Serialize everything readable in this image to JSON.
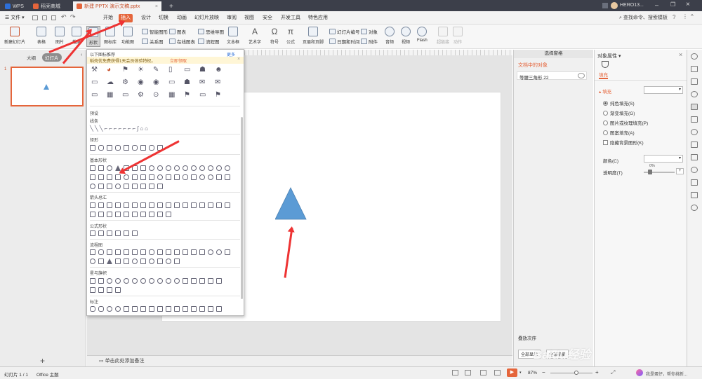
{
  "titlebar": {
    "tabs": [
      {
        "label": "WPS"
      },
      {
        "label": "稻壳商城"
      },
      {
        "label": "新建 PPTX 演示文稿.pptx"
      }
    ],
    "user": "HERO13..."
  },
  "menubar": {
    "file": "文件",
    "items": [
      "开始",
      "插入",
      "设计",
      "切换",
      "动画",
      "幻灯片放映",
      "审阅",
      "视图",
      "安全",
      "开发工具",
      "特色应用"
    ],
    "search": "查找命令、搜索模板"
  },
  "toolbar": {
    "new_slide": "新建幻灯片",
    "table": "表格",
    "image": "图片",
    "screenshot": "截屏",
    "shape": "形状",
    "icon_lib": "图标库",
    "func_chart": "功能图",
    "smart_art": "智能图形",
    "chart": "图表",
    "mindmap": "思维导图",
    "relation": "关系图",
    "online_chart": "在线图表",
    "flowchart": "流程图",
    "textbox": "文本框",
    "art_text": "艺术字",
    "symbol": "符号",
    "formula": "公式",
    "header_footer": "页眉和页脚",
    "slide_number": "幻灯片编号",
    "date_time": "日期和时间",
    "object": "对象",
    "attachment": "附件",
    "audio": "音频",
    "video": "视频",
    "flash": "Flash",
    "hyperlink": "超链接",
    "action": "动作"
  },
  "leftpanel": {
    "tab_outline": "大纲",
    "tab_slides": "幻灯片",
    "slide_number": "1"
  },
  "popup": {
    "header": "以下图标推荐",
    "more": "更多",
    "promo": "稻壳优免费获得1天会员体验特权。",
    "promo_link": "立即领取",
    "sections": [
      "预设",
      "线条",
      "矩形",
      "基本形状",
      "箭头总汇",
      "公式形状",
      "流程图",
      "星与旗帜",
      "标注"
    ]
  },
  "notes": {
    "placeholder": "单击此处添加备注"
  },
  "selpane": {
    "title": "选择窗格",
    "objects_label": "文档中的对象",
    "item": "等腰三角形 22",
    "order_label": "叠放次序",
    "show_all": "全部显示",
    "hide_all": "全部隐藏"
  },
  "proppane": {
    "title": "对象属性",
    "tab_fill": "填充",
    "section_fill": "填充",
    "options": [
      "纯色填充(S)",
      "渐变填充(G)",
      "图片或纹理填充(P)",
      "图案填充(A)"
    ],
    "hide_bg": "隐藏背景图形(K)",
    "color_label": "颜色(C)",
    "transparency_label": "透明度(T)",
    "transparency_value": "0%"
  },
  "statusbar": {
    "slide_info": "幻灯片 1 / 1",
    "theme": "Office 主题",
    "zoom": "87%",
    "assistant": "我是蛋仔，帮你挑新..."
  },
  "colors": {
    "accent": "#e5653b",
    "shape_fill": "#5b9bd5",
    "arrow": "#e33333"
  },
  "watermark": "Baidu经验"
}
